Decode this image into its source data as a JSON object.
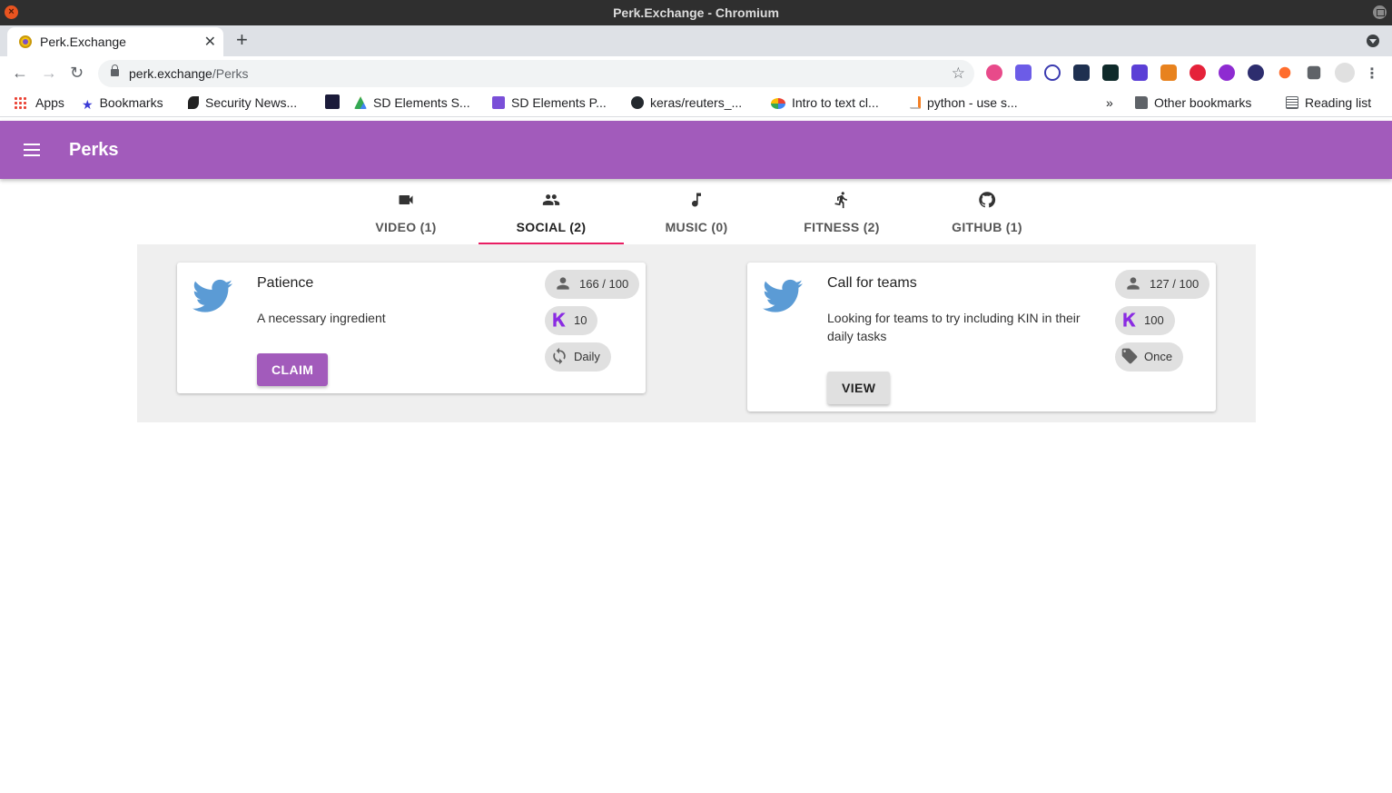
{
  "os": {
    "window_title": "Perk.Exchange - Chromium"
  },
  "browser": {
    "tab_title": "Perk.Exchange",
    "url_host": "perk.exchange",
    "url_path": "/Perks",
    "bookmarks": [
      {
        "label": "Apps",
        "icon": "apps-grid-icon"
      },
      {
        "label": "Bookmarks",
        "icon": "star-icon"
      },
      {
        "label": "Security News...",
        "icon": "feed-icon"
      },
      {
        "label": "SD Elements S...",
        "icon": "google-drive-icon"
      },
      {
        "label": "SD Elements P...",
        "icon": "google-docs-icon"
      },
      {
        "label": "keras/reuters_...",
        "icon": "github-icon"
      },
      {
        "label": "Intro to text cl...",
        "icon": "google-cloud-icon"
      },
      {
        "label": "python - use s...",
        "icon": "stackoverflow-icon"
      }
    ],
    "overflow_label": "»",
    "other_bookmarks": "Other bookmarks",
    "reading_list": "Reading list"
  },
  "app": {
    "title": "Perks",
    "accent_color": "#a25bbb",
    "tabs": [
      {
        "label": "VIDEO (1)",
        "icon": "videocam-icon"
      },
      {
        "label": "SOCIAL (2)",
        "icon": "people-icon",
        "active": true
      },
      {
        "label": "MUSIC (0)",
        "icon": "music-note-icon"
      },
      {
        "label": "FITNESS (2)",
        "icon": "run-icon"
      },
      {
        "label": "GITHUB (1)",
        "icon": "github-icon"
      }
    ]
  },
  "perks": [
    {
      "icon": "twitter-icon",
      "title": "Patience",
      "description": "A necessary ingredient",
      "count": "166 / 100",
      "reward": "10",
      "frequency": "Daily",
      "frequency_icon": "repeat-icon",
      "action": "CLAIM"
    },
    {
      "icon": "twitter-icon",
      "title": "Call for teams",
      "description": "Looking for teams to try including KIN in their daily tasks",
      "count": "127 / 100",
      "reward": "100",
      "frequency": "Once",
      "frequency_icon": "tag-icon",
      "action": "VIEW"
    }
  ]
}
